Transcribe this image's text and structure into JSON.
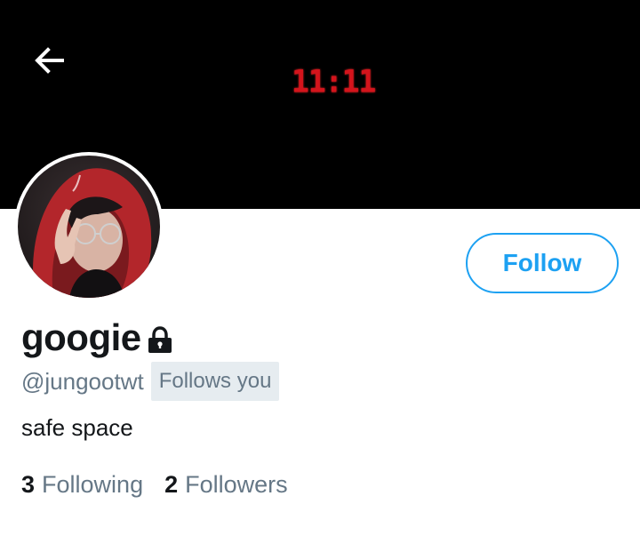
{
  "header": {
    "back_icon": "arrow-left-icon",
    "banner_clock_text": "11:11"
  },
  "profile": {
    "display_name": "googie",
    "protected_icon": "lock-icon",
    "handle": "@jungootwt",
    "follows_you_label": "Follows you",
    "bio": "safe space",
    "follow_button_label": "Follow"
  },
  "stats": {
    "following_count": "3",
    "following_label": "Following",
    "followers_count": "2",
    "followers_label": "Followers"
  },
  "colors": {
    "accent": "#1da1f2",
    "secondary_text": "#657786",
    "primary_text": "#14171a",
    "badge_bg": "#e6ecf0",
    "clock_red": "#d4141c"
  }
}
